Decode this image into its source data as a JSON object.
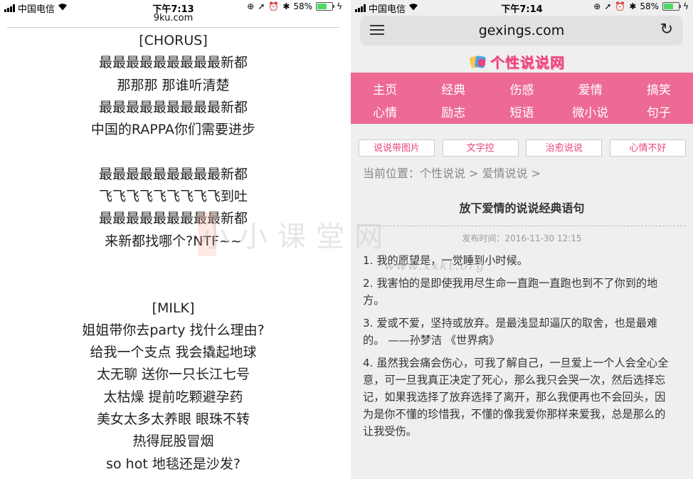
{
  "left": {
    "status": {
      "carrier": "中国电信",
      "time": "下午7:13",
      "battery": "58%",
      "battery_level": 0.58
    },
    "url": "9ku.com",
    "lyrics": [
      "[CHORUS]",
      "最最最最最最最最最新都",
      "那那那 那谁听清楚",
      "最最最最最最最最最新都",
      "中国的RAPPA你们需要进步",
      "",
      "最最最最最最最最最新都",
      "飞飞飞飞飞飞飞飞飞到吐",
      "最最最最最最最最最新都",
      "来新都找哪个?NTF~~",
      "",
      "",
      "[MILK]",
      "姐姐带你去party 找什么理由?",
      "给我一个支点 我会撬起地球",
      "太无聊 送你一只长江七号",
      "太枯燥 提前吃颗避孕药",
      "美女太多太养眼 眼珠不转",
      "热得屁股冒烟",
      "so hot 地毯还是沙发?"
    ]
  },
  "watermark": {
    "text": "小小课堂网",
    "url": "www.xxkt.org"
  },
  "right": {
    "status": {
      "carrier": "中国电信",
      "time": "下午7:14",
      "battery": "58%",
      "battery_level": 0.58
    },
    "domain": "gexings.com",
    "site_name": "个性说说网",
    "nav_row1": [
      "主页",
      "经典",
      "伤感",
      "爱情",
      "搞笑"
    ],
    "nav_row2": [
      "心情",
      "励志",
      "短语",
      "微小说",
      "句子"
    ],
    "tags": [
      "说说带图片",
      "文字控",
      "治愈说说",
      "心情不好"
    ],
    "breadcrumb": "当前位置：个性说说 > 爱情说说 >",
    "title": "放下爱情的说说经典语句",
    "pubdate": "发布时间：2016-11-30 12:15",
    "paragraphs": [
      "1. 我的愿望是，一觉睡到小时候。",
      "2. 我害怕的是即使我用尽生命一直跑一直跑也到不了你到的地方。",
      "3. 爱或不爱，坚持或放弃。是最浅显却逼仄的取舍，也是最难的。 ——孙梦洁 《世界病》",
      "4. 虽然我会痛会伤心，可我了解自己，一旦爱上一个人会全心全意，可一旦我真正决定了死心，那么我只会哭一次，然后选择忘记，如果我选择了放弃选择了离开，那么我便再也不会回头，因为是你不懂的珍惜我，不懂的像我爱你那样来爱我，总是那么的让我受伤。"
    ]
  },
  "colors": {
    "nav_bg": "#ec6a93",
    "accent": "#e8457c"
  }
}
